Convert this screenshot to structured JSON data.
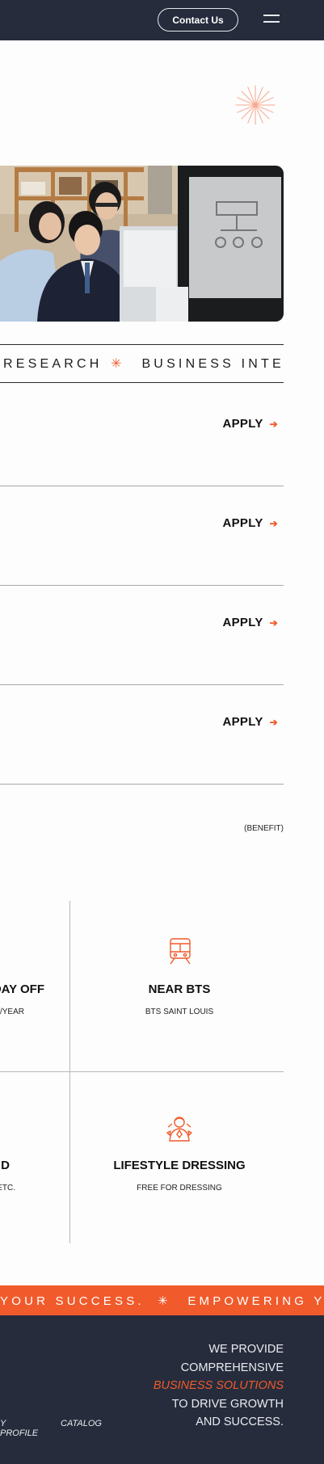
{
  "header": {
    "contact_label": "Contact Us"
  },
  "ticker_top": {
    "segments": [
      "RESEARCH",
      "BUSINESS INTEL"
    ]
  },
  "jobs": [
    {
      "apply_label": "APPLY"
    },
    {
      "apply_label": "APPLY"
    },
    {
      "apply_label": "APPLY"
    },
    {
      "apply_label": "APPLY"
    }
  ],
  "benefits_tag": "(BENEFIT)",
  "benefits": [
    {
      "title": "DAY OFF",
      "sub": "/YEAR",
      "icon": "calendar-icon"
    },
    {
      "title": "NEAR BTS",
      "sub": "BTS SAINT LOUIS",
      "icon": "train-icon"
    },
    {
      "title": "D",
      "sub": "ETC.",
      "icon": "none"
    },
    {
      "title": "LIFESTYLE DRESSING",
      "sub": "FREE FOR DRESSING",
      "icon": "dressing-person-icon"
    }
  ],
  "ticker_bottom": {
    "segments": [
      "YOUR SUCCESS.",
      "EMPOWERING Y"
    ]
  },
  "footer": {
    "tagline": [
      "WE PROVIDE",
      "COMPREHENSIVE",
      "BUSINESS SOLUTIONS",
      "TO DRIVE GROWTH",
      "AND SUCCESS."
    ],
    "links": [
      "Y PROFILE",
      "CATALOG"
    ]
  },
  "colors": {
    "accent": "#f15a2b",
    "dark": "#262c3c"
  }
}
